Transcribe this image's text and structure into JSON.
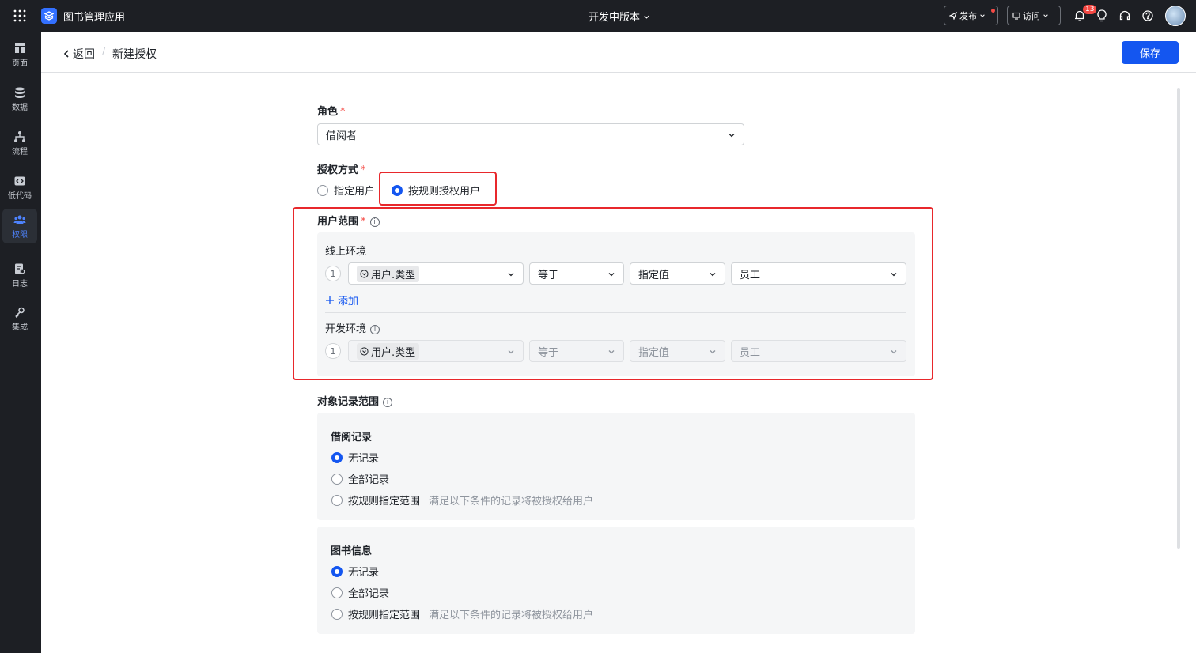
{
  "topbar": {
    "app_name": "图书管理应用",
    "version_label": "开发中版本",
    "publish_label": "发布",
    "visit_label": "访问",
    "notification_count": "13"
  },
  "sidebar": {
    "items": [
      {
        "label": "页面",
        "icon": "page-icon"
      },
      {
        "label": "数据",
        "icon": "database-icon"
      },
      {
        "label": "流程",
        "icon": "flow-icon"
      },
      {
        "label": "低代码",
        "icon": "code-icon"
      },
      {
        "label": "权限",
        "icon": "users-icon",
        "active": true
      },
      {
        "label": "日志",
        "icon": "log-icon"
      },
      {
        "label": "集成",
        "icon": "key-icon"
      }
    ]
  },
  "header": {
    "back_label": "返回",
    "separator": "/",
    "title": "新建授权",
    "save_label": "保存"
  },
  "form": {
    "role": {
      "label": "角色",
      "value": "借阅者"
    },
    "auth_method": {
      "label": "授权方式",
      "options": [
        "指定用户",
        "按规则授权用户"
      ],
      "selected": "按规则授权用户"
    },
    "user_scope": {
      "label": "用户范围",
      "online": {
        "label": "线上环境",
        "rule_index": "1",
        "field": "用户.类型",
        "operator": "等于",
        "value_type": "指定值",
        "value": "员工",
        "add_label": "添加"
      },
      "dev": {
        "label": "开发环境",
        "rule_index": "1",
        "field": "用户.类型",
        "operator": "等于",
        "value_type": "指定值",
        "value": "员工"
      }
    },
    "object_scope": {
      "label": "对象记录范围",
      "objects": [
        {
          "name": "借阅记录",
          "options": [
            "无记录",
            "全部记录",
            "按规则指定范围"
          ],
          "selected": "无记录",
          "rule_hint": "满足以下条件的记录将被授权给用户"
        },
        {
          "name": "图书信息",
          "options": [
            "无记录",
            "全部记录",
            "按规则指定范围"
          ],
          "selected": "无记录",
          "rule_hint": "满足以下条件的记录将被授权给用户"
        }
      ]
    }
  },
  "colors": {
    "accent": "#1456f0",
    "highlight": "#e8282c",
    "topbar_bg": "#1d1f24"
  }
}
